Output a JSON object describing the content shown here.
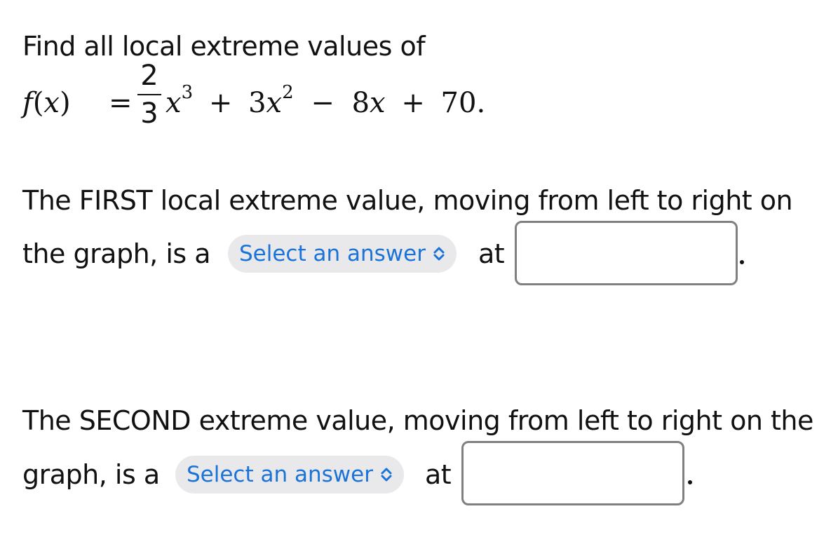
{
  "prompt": {
    "intro": "Find all local extreme values of",
    "function": {
      "lhs": "f(x)",
      "equals": "=",
      "frac_num": "2",
      "frac_den": "3",
      "term1_var": "x",
      "term1_exp": "3",
      "op1": "+",
      "term2_coef": "3",
      "term2_var": "x",
      "term2_exp": "2",
      "op2": "−",
      "term3": "8x",
      "op3": "+",
      "constant": "70."
    }
  },
  "first": {
    "line1": "The FIRST local extreme value, moving from left to right on",
    "line2_prefix": "the graph, is a",
    "select_label": "Select an answer",
    "at_label": "at",
    "answer_value": "",
    "period": "."
  },
  "second": {
    "line1": "The SECOND extreme value, moving from left to right on the",
    "line2_prefix": "graph, is a",
    "select_label": "Select an answer",
    "at_label": "at",
    "answer_value": "",
    "period": "."
  },
  "colors": {
    "select_text": "#1a73d9",
    "select_bg": "#e9e9eb",
    "input_border": "#808080"
  }
}
